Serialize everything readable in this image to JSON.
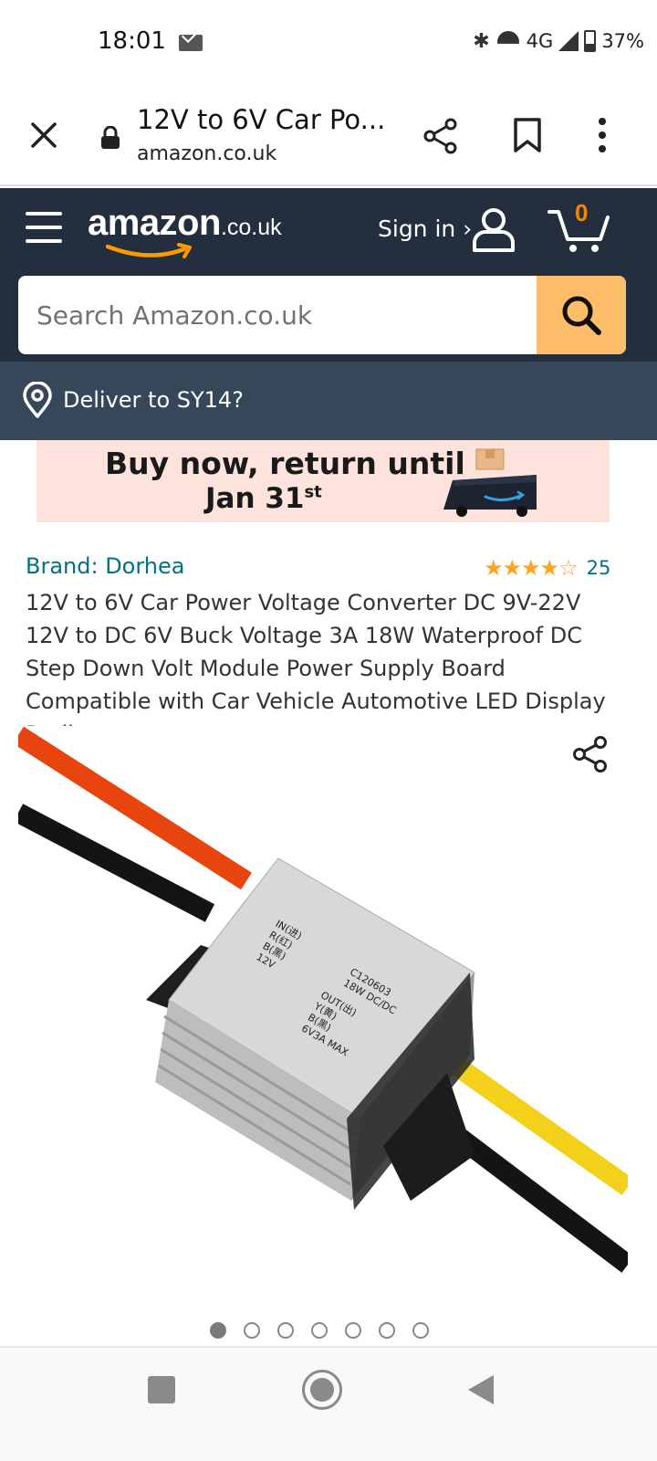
{
  "status_bar": {
    "time": "18:01",
    "network": "4G",
    "battery": "37%",
    "icons": [
      "mail-icon",
      "bluetooth-icon",
      "wifi-icon",
      "signal-icon",
      "battery-icon"
    ]
  },
  "browser": {
    "title": "12V to 6V Car Po...",
    "url": "amazon.co.uk",
    "icons": [
      "close-icon",
      "lock-icon",
      "share-icon",
      "bookmark-icon",
      "more-vert-icon"
    ]
  },
  "amazon_header": {
    "logo_word": "amazon",
    "logo_tld": ".co.uk",
    "sign_in": "Sign in ›",
    "cart_count": "0",
    "search_placeholder": "Search Amazon.co.uk",
    "deliver_to": "Deliver to SY14?",
    "colors": {
      "header_bg": "#232f3e",
      "deliver_bg": "#37475a",
      "search_button": "#febd69",
      "cart_count": "#f08804"
    }
  },
  "banner": {
    "line1": "Buy now, return until",
    "line2_main": "Jan 31",
    "line2_sup": "st"
  },
  "product": {
    "brand": "Brand: Dorhea",
    "stars_display": "★★★★☆",
    "rating_value": 4.5,
    "rating_count": "25",
    "title": "12V to 6V Car Power Voltage Converter DC 9V-22V 12V to DC 6V Buck Voltage 3A 18W Waterproof DC Step Down Volt Module Power Supply Board Compatible with Car Vehicle Automotive LED Display Radio",
    "module_labels": {
      "in_block": [
        "IN(进)",
        "R(红)",
        "B(黑)",
        "12V"
      ],
      "model": "C120603",
      "spec": "18W DC/DC",
      "out_block": [
        "OUT(出)",
        "Y(黄)",
        "B(黑)",
        "6V3A MAX"
      ]
    }
  },
  "carousel": {
    "total": 7,
    "active_index": 0
  },
  "nav_bar": {
    "icons": [
      "recents-icon",
      "home-icon",
      "back-icon"
    ]
  }
}
